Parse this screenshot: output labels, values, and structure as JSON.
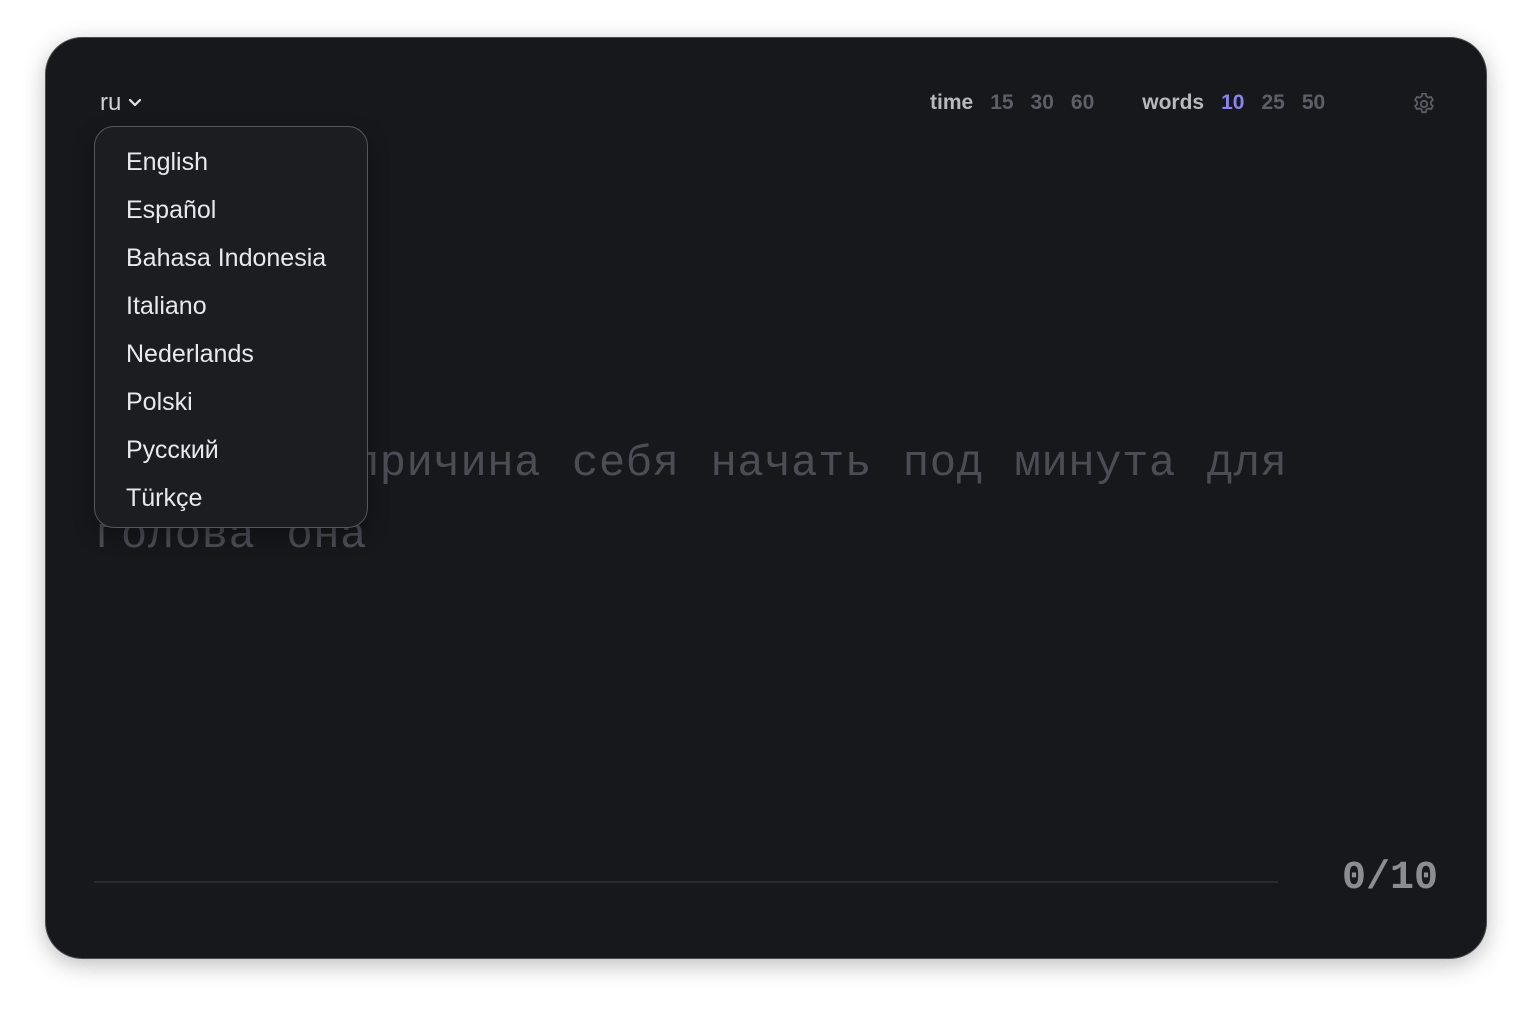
{
  "language": {
    "current": "ru",
    "options": [
      "English",
      "Español",
      "Bahasa Indonesia",
      "Italiano",
      "Nederlands",
      "Polski",
      "Русский",
      "Türkçe"
    ]
  },
  "modes": {
    "time": {
      "label": "time",
      "options": [
        "15",
        "30",
        "60"
      ]
    },
    "words": {
      "label": "words",
      "options": [
        "10",
        "25",
        "50"
      ],
      "selected": "10"
    }
  },
  "test": {
    "line1": "ка причина себя начать под минута для",
    "line2": "голова она"
  },
  "progress": {
    "counter": "0/10",
    "fraction": 0
  },
  "colors": {
    "accent": "#8b83ec",
    "background": "#17181c",
    "untyped_text": "#4b4d55"
  },
  "icons": {
    "language_toggle": "chevron-down-icon",
    "settings": "gear-icon"
  }
}
